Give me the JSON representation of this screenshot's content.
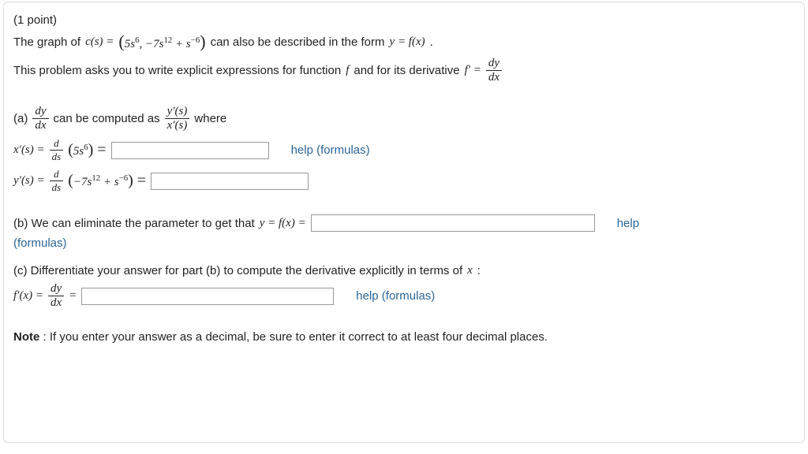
{
  "points_label": "(1 point)",
  "intro1_pre": "The graph of ",
  "intro1_eq_lhs": "c(s) = ",
  "intro1_paren_open": "(",
  "intro1_term1_base": "5s",
  "intro1_term1_exp": "6",
  "intro1_sep1": ", −7s",
  "intro1_term2_exp": "12",
  "intro1_sep2": " + s",
  "intro1_term3_exp": "−6",
  "intro1_paren_close": ")",
  "intro1_post": " can also be described in the form ",
  "intro1_yfx": "y = f(x)",
  "intro1_period": ".",
  "intro2": "This problem asks you to write explicit expressions for function ",
  "intro2_f": "f",
  "intro2_mid": " and for its derivative ",
  "intro2_fp": "f′ = ",
  "dy": "dy",
  "dx": "dx",
  "part_a_label": "(a) ",
  "part_a_mid": " can be computed as ",
  "yps": "y′(s)",
  "xps": "x′(s)",
  "part_a_where": " where",
  "xps_lhs1": "x′(s) = ",
  "dds_num": "d",
  "dds_den": "ds",
  "xps_arg_open": "(",
  "xps_arg_base": "5s",
  "xps_arg_exp": "6",
  "xps_arg_close": ") = ",
  "help_formulas": "help (formulas)",
  "help_only": "help",
  "formulas_only": "(formulas)",
  "yps_lhs1": "y′(s) = ",
  "yps_arg_open": "(−7s",
  "yps_arg_exp1": "12",
  "yps_arg_mid": " + s",
  "yps_arg_exp2": "−6",
  "yps_arg_close": ") = ",
  "part_b_text1": "(b) We can eliminate the parameter to get that ",
  "part_b_eq": "y = f(x) = ",
  "part_c_text": "(c) Differentiate your answer for part (b) to compute the derivative explicitly in terms of ",
  "part_c_x": "x",
  "part_c_colon": ":",
  "fpx_lhs": "f′(x) = ",
  "eq_after_frac": " = ",
  "note_label": "Note",
  "note_text": " : If you enter your answer as a decimal, be sure to enter it correct to at least four decimal places."
}
